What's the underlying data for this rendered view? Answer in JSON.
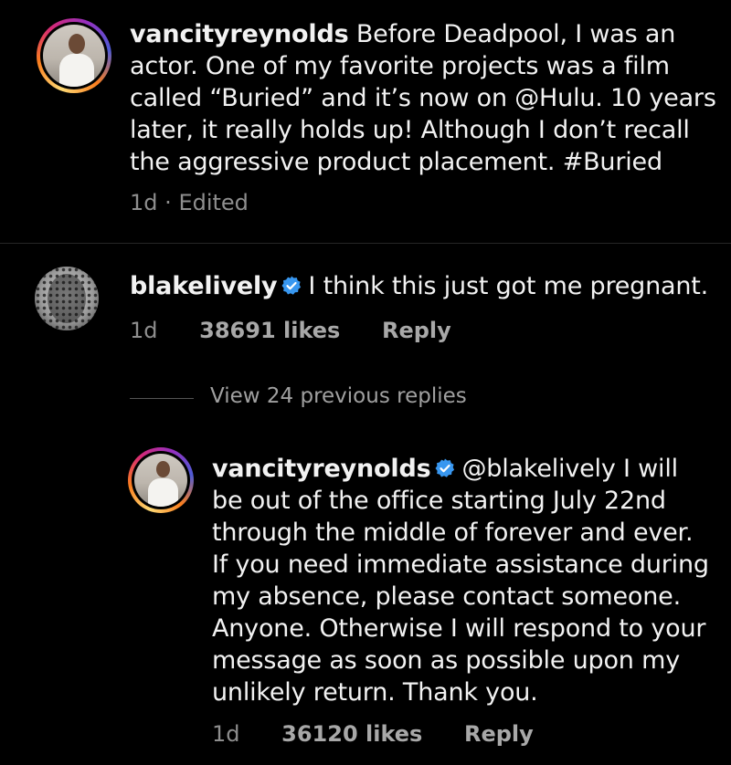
{
  "post": {
    "username": "vancityreynolds",
    "caption": "Before Deadpool, I was an actor. One of my favorite projects was a film called “Buried” and it’s now on @Hulu. 10 years later, it really holds up! Although I don’t recall the aggressive product placement. #Buried",
    "time": "1d",
    "edited": "Edited",
    "separator": "·"
  },
  "comments": [
    {
      "username": "blakelively",
      "verified": true,
      "text": "I think this just got me pregnant.",
      "time": "1d",
      "likes": "38691 likes",
      "reply": "Reply"
    }
  ],
  "replies": {
    "view_previous": "View 24 previous replies",
    "items": [
      {
        "username": "vancityreynolds",
        "verified": true,
        "text": "@blakelively I will be out of the office starting July 22nd through the middle of forever and ever. If you need immediate assistance during my absence, please contact someone. Anyone. Otherwise I will respond to your message as soon as possible upon my unlikely return. Thank you.",
        "time": "1d",
        "likes": "36120 likes",
        "reply": "Reply"
      }
    ]
  },
  "colors": {
    "background": "#000000",
    "text": "#f2f2f2",
    "muted": "#8e8e8e",
    "verified": "#3897f0"
  }
}
